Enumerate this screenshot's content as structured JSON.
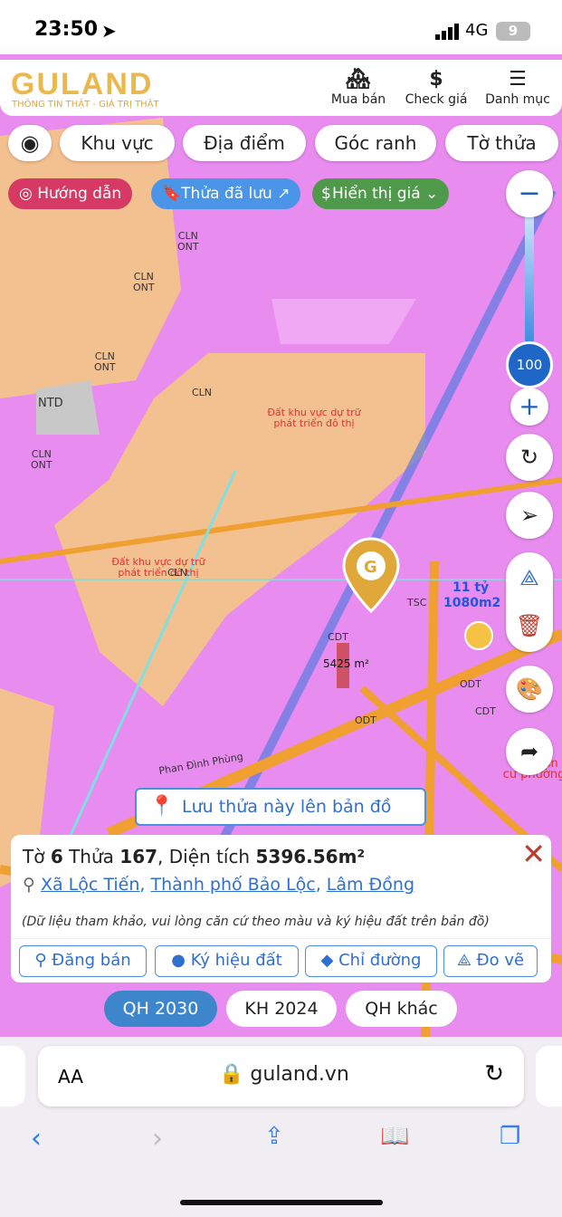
{
  "status_bar": {
    "time": "23:50",
    "network": "4G",
    "battery": "9"
  },
  "header": {
    "logo": "GULAND",
    "tagline": "THÔNG TIN THẬT - GIÁ TRỊ THẬT",
    "nav": [
      {
        "label": "Mua bán",
        "icon": "building-icon"
      },
      {
        "label": "Check giá",
        "icon": "dollar-icon"
      },
      {
        "label": "Danh mục",
        "icon": "menu-icon"
      }
    ]
  },
  "filters": [
    "Khu vực",
    "Địa điểm",
    "Góc ranh",
    "Tờ thửa"
  ],
  "chips": {
    "guide": "Hướng dẫn",
    "saved": "Thửa đã lưu",
    "price": "Hiển thị giá"
  },
  "zoom_level": "100",
  "map_labels": {
    "cln": "CLN",
    "ont": "ONT",
    "odt": "ODT",
    "ntd": "NTD",
    "cdt": "CDT",
    "reserve": "Đất khu vực dự trữ phát triển đô thị",
    "street": "Phan Đình Phùng",
    "area": "5425 m²",
    "price": "11 tỷ",
    "price_area": "1080m2",
    "tsc": "TSC",
    "residential": "Khu dân cư phường"
  },
  "save_parcel": "Lưu thửa này lên bản đồ",
  "parcel": {
    "sheet_label": "Tờ",
    "sheet": "6",
    "parcel_label": "Thửa",
    "parcel": "167",
    "area_label": ", Diện tích",
    "area": "5396.56m²",
    "commune": "Xã Lộc Tiến",
    "city": "Thành phố Bảo Lộc",
    "province": "Lâm Đồng",
    "note": "(Dữ liệu tham khảo, vui lòng căn cứ theo màu và ký hiệu đất trên bản đồ)",
    "actions": [
      "Đăng bán",
      "Ký hiệu đất",
      "Chỉ đường",
      "Đo vẽ"
    ]
  },
  "plans": [
    {
      "label": "QH 2030",
      "active": true
    },
    {
      "label": "KH 2024",
      "active": false
    },
    {
      "label": "QH khác",
      "active": false
    }
  ],
  "browser": {
    "aa": "AA",
    "url": "guland.vn"
  },
  "colors": {
    "brand": "#eab84c",
    "accent": "#2f6fd0",
    "guide": "#d63a64",
    "saved": "#4a95e8",
    "price": "#4f9a4a"
  }
}
